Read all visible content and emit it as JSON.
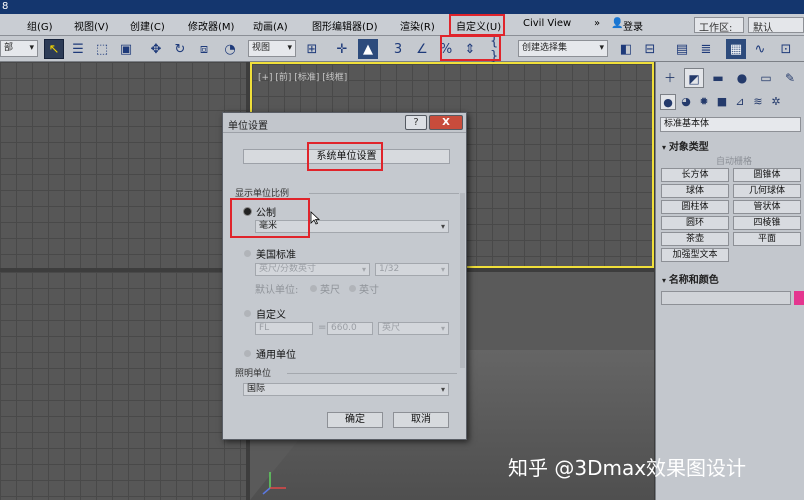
{
  "titlebar": {
    "label": "8"
  },
  "menu": {
    "items": [
      "组(G)",
      "视图(V)",
      "创建(C)",
      "修改器(M)",
      "动画(A)",
      "图形编辑器(D)",
      "渲染(R)",
      "自定义(U)",
      "Civil View",
      "»",
      "登录",
      "工作区:",
      "默认"
    ]
  },
  "toolbar": {
    "left_dropdown": "部",
    "view_dropdown": "视图",
    "selection_set_dropdown": "创建选择集"
  },
  "viewport": {
    "top_right_label": "[+] [前] [标准] [线框]"
  },
  "command_panel": {
    "dropdown": "标准基本体",
    "object_type_title": "对象类型",
    "auto_grid": "自动栅格",
    "buttons": [
      "长方体",
      "圆锥体",
      "球体",
      "几何球体",
      "圆柱体",
      "管状体",
      "圆环",
      "四棱锥",
      "茶壶",
      "平面",
      "加强型文本"
    ],
    "name_color_title": "名称和颜色",
    "color": "#e4368f"
  },
  "dialog": {
    "title": "单位设置",
    "help_label": "?",
    "close_label": "X",
    "system_unit_button": "系统单位设置",
    "display_group_title": "显示单位比例",
    "metric_label": "公制",
    "metric_unit": "毫米",
    "us_label": "美国标准",
    "us_unit": "英尺/分数英寸",
    "us_fraction": "1/32",
    "default_unit_label": "默认单位:",
    "feet_label": "英尺",
    "inch_label": "英寸",
    "custom_label": "自定义",
    "custom_name": "FL",
    "custom_equals": "=",
    "custom_value": "660.0",
    "custom_unit": "英尺",
    "generic_label": "通用单位",
    "lighting_group_title": "照明单位",
    "lighting_unit": "国际",
    "ok_label": "确定",
    "cancel_label": "取消"
  },
  "watermark": "知乎 @3Dmax效果图设计"
}
